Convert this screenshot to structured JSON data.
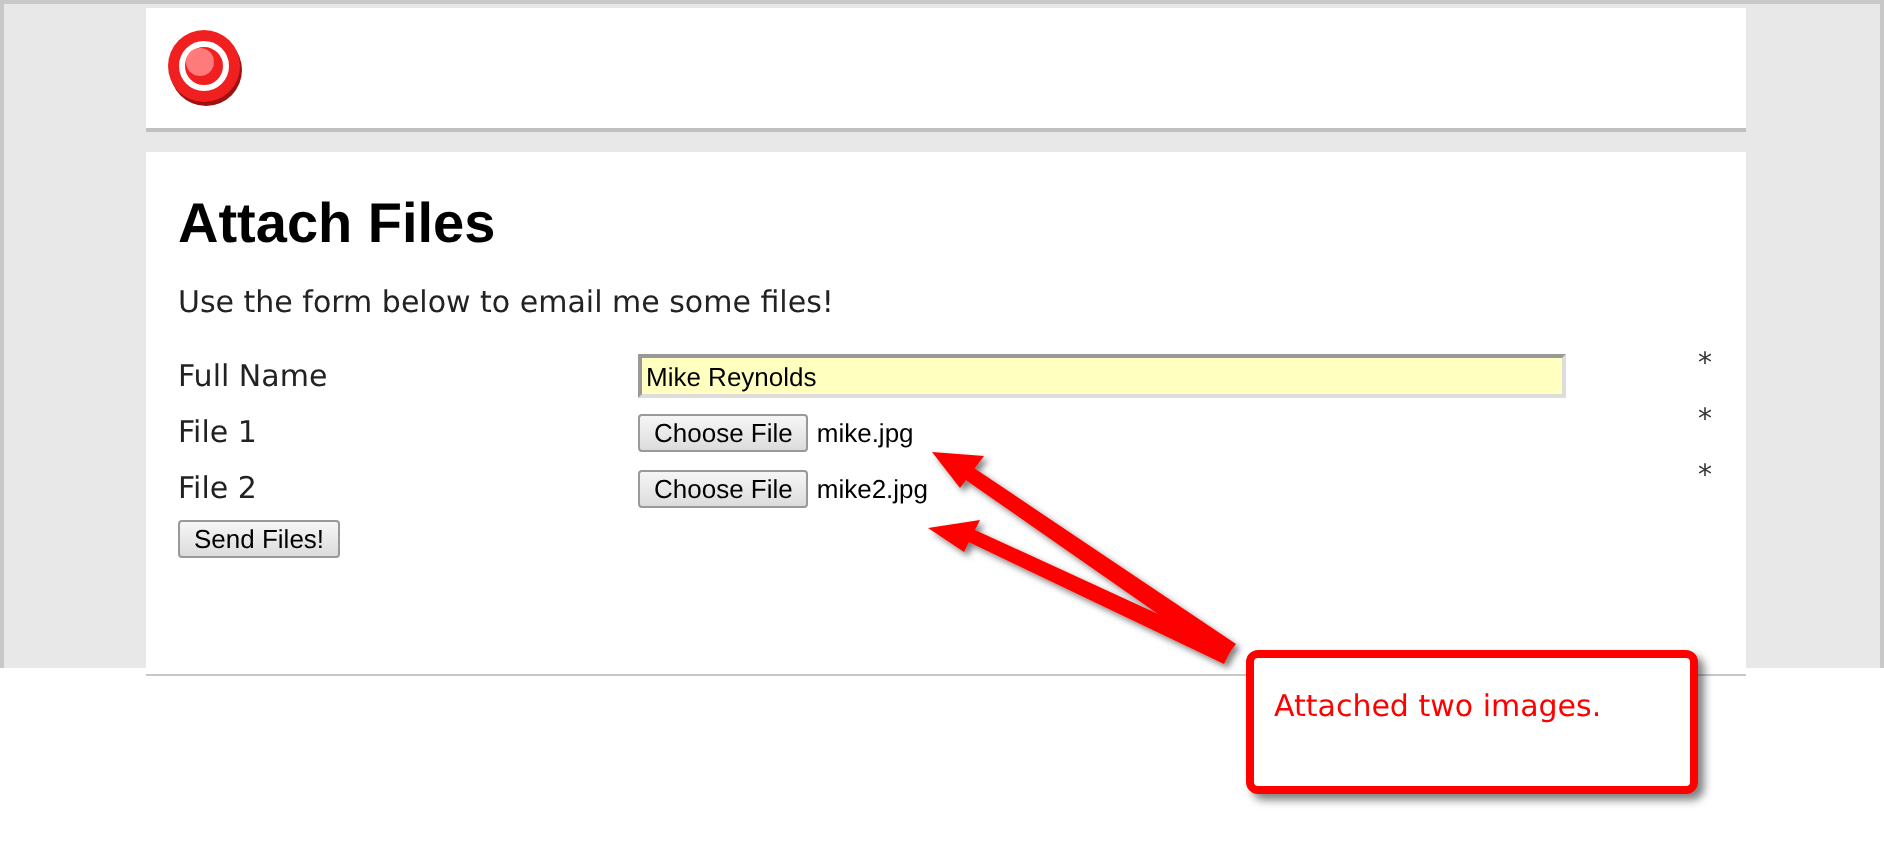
{
  "page": {
    "title": "Attach Files",
    "intro": "Use the form below to email me some files!"
  },
  "fields": [
    {
      "kind": "text",
      "label": "Full Name",
      "value": "Mike Reynolds",
      "required_mark": "*"
    },
    {
      "kind": "file",
      "label": "File 1",
      "button": "Choose File",
      "file_name": "mike.jpg",
      "required_mark": "*"
    },
    {
      "kind": "file",
      "label": "File 2",
      "button": "Choose File",
      "file_name": "mike2.jpg",
      "required_mark": "*"
    }
  ],
  "submit": "Send Files!",
  "annotation": {
    "text": "Attached two images."
  }
}
